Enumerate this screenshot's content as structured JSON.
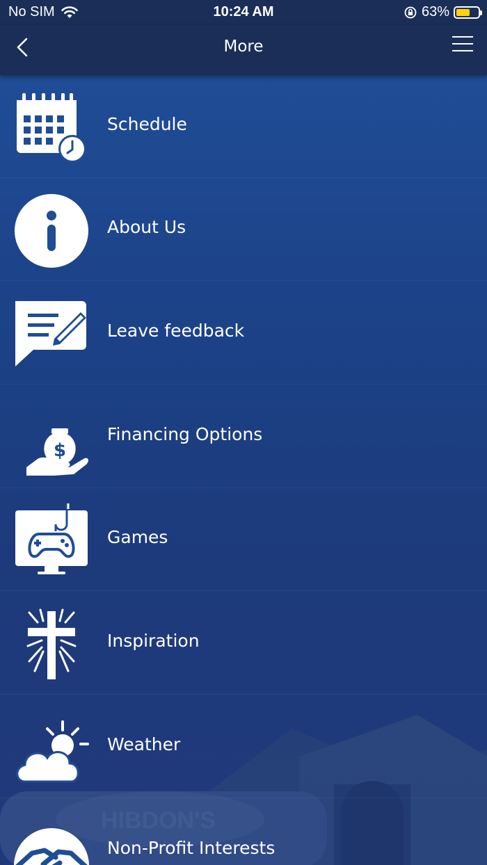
{
  "status": {
    "carrier": "No SIM",
    "time": "10:24 AM",
    "battery_text": "63%",
    "battery_level": 0.63
  },
  "nav": {
    "title": "More"
  },
  "menu": [
    {
      "label": "Schedule",
      "icon": "calendar-clock-icon"
    },
    {
      "label": "About Us",
      "icon": "info-icon"
    },
    {
      "label": "Leave feedback",
      "icon": "feedback-icon"
    },
    {
      "label": "Financing Options",
      "icon": "money-bag-hand-icon"
    },
    {
      "label": "Games",
      "icon": "game-controller-monitor-icon"
    },
    {
      "label": "Inspiration",
      "icon": "cross-icon"
    },
    {
      "label": "Weather",
      "icon": "weather-icon"
    },
    {
      "label": "Non-Profit Interests",
      "icon": "handshake-icon"
    }
  ],
  "colors": {
    "nav_background": "#1a2e57",
    "content_background": "#1f4d96",
    "battery_fill": "#ffd20a"
  }
}
